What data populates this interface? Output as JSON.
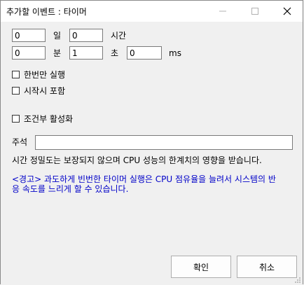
{
  "window": {
    "title": "추가할 이벤트 : 타이머",
    "minimize_icon": "minimize-icon",
    "maximize_icon": "maximize-icon",
    "close_icon": "close-icon"
  },
  "time": {
    "days_value": "0",
    "days_label": "일",
    "hours_value": "0",
    "hours_label": "시간",
    "minutes_value": "0",
    "minutes_label": "분",
    "seconds_value": "1",
    "seconds_label": "초",
    "ms_value": "0",
    "ms_label": "ms"
  },
  "options": {
    "run_once_label": "한번만 실행",
    "run_once_checked": false,
    "include_start_label": "시작시 포함",
    "include_start_checked": false,
    "conditional_label": "조건부 활성화",
    "conditional_checked": false
  },
  "comment": {
    "label": "주석",
    "value": ""
  },
  "notes": {
    "precision": "시간 정밀도는 보장되지 않으며 CPU 성능의 한계치의 영향을 받습니다.",
    "warning_line1": "<경고> 과도하게 빈번한 타이머 실행은 CPU 점유율을 늘려서 시스템의 반",
    "warning_line2": "응 속도를 느리게 할 수 있습니다.",
    "warning_color": "#0000c8"
  },
  "buttons": {
    "ok_label": "확인",
    "cancel_label": "취소"
  }
}
